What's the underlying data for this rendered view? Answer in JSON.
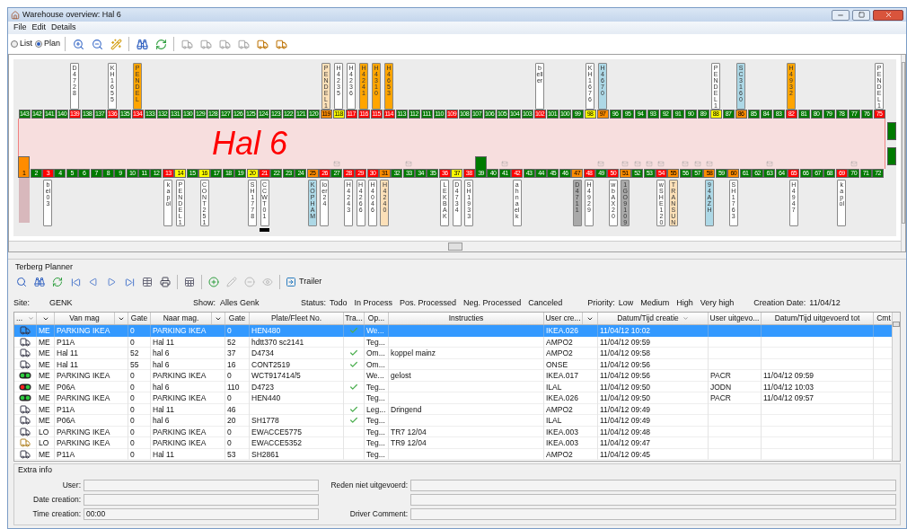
{
  "window": {
    "title": "Warehouse overview: Hal 6"
  },
  "menu": [
    "File",
    "Edit",
    "Details"
  ],
  "view_modes": [
    {
      "label": "List",
      "selected": false
    },
    {
      "label": "Plan",
      "selected": true
    }
  ],
  "truck_buttons": [
    {
      "disabled": true
    },
    {
      "disabled": true
    },
    {
      "disabled": true
    },
    {
      "disabled": true
    },
    {
      "disabled": false
    },
    {
      "disabled": false
    }
  ],
  "plan": {
    "hall_name": "Hal 6",
    "side_gates": [
      {
        "color": "#007a00"
      },
      {
        "color": "#007a00"
      }
    ],
    "top_docks": [
      {
        "no": "143",
        "color": "#007a00"
      },
      {
        "no": "142",
        "color": "#007a00"
      },
      {
        "no": "141",
        "color": "#007a00"
      },
      {
        "no": "140",
        "color": "#007a00"
      },
      {
        "no": "139",
        "color": "#ff0000",
        "label": {
          "text": "D4728",
          "color": "#ffffff"
        }
      },
      {
        "no": "138",
        "color": "#007a00"
      },
      {
        "no": "137",
        "color": "#007a00"
      },
      {
        "no": "136",
        "color": "#ff0000",
        "label": {
          "text": "KH1655",
          "color": "#ffffff"
        }
      },
      {
        "no": "135",
        "color": "#007a00"
      },
      {
        "no": "134",
        "color": "#ff0000",
        "label": {
          "text": "PENDEL",
          "color": "#ffa500"
        }
      },
      {
        "no": "133",
        "color": "#007a00"
      },
      {
        "no": "132",
        "color": "#007a00"
      },
      {
        "no": "131",
        "color": "#007a00"
      },
      {
        "no": "130",
        "color": "#007a00"
      },
      {
        "no": "129",
        "color": "#007a00"
      },
      {
        "no": "128",
        "color": "#007a00"
      },
      {
        "no": "127",
        "color": "#007a00"
      },
      {
        "no": "126",
        "color": "#007a00"
      },
      {
        "no": "125",
        "color": "#007a00"
      },
      {
        "no": "124",
        "color": "#007a00"
      },
      {
        "no": "123",
        "color": "#007a00"
      },
      {
        "no": "122",
        "color": "#007a00"
      },
      {
        "no": "121",
        "color": "#007a00"
      },
      {
        "no": "120",
        "color": "#007a00"
      },
      {
        "no": "119",
        "color": "#ff8c00",
        "label": {
          "text": "PENDEL1",
          "color": "#fce0b8"
        }
      },
      {
        "no": "118",
        "color": "#ffff00",
        "label": {
          "text": "H4235",
          "color": "#ffffff"
        }
      },
      {
        "no": "117",
        "color": "#ff0000",
        "label": {
          "text": "H4236",
          "color": "#ffffff"
        }
      },
      {
        "no": "116",
        "color": "#ff0000",
        "label": {
          "text": "H4241",
          "color": "#ffa500"
        }
      },
      {
        "no": "115",
        "color": "#ff0000",
        "label": {
          "text": "H4310",
          "color": "#ffa500"
        }
      },
      {
        "no": "114",
        "color": "#ff0000",
        "label": {
          "text": "H4653",
          "color": "#ffa500"
        }
      },
      {
        "no": "113",
        "color": "#007a00"
      },
      {
        "no": "112",
        "color": "#007a00"
      },
      {
        "no": "111",
        "color": "#007a00"
      },
      {
        "no": "110",
        "color": "#007a00"
      },
      {
        "no": "109",
        "color": "#ff0000"
      },
      {
        "no": "108",
        "color": "#007a00"
      },
      {
        "no": "107",
        "color": "#007a00"
      },
      {
        "no": "106",
        "color": "#007a00"
      },
      {
        "no": "105",
        "color": "#007a00"
      },
      {
        "no": "104",
        "color": "#007a00"
      },
      {
        "no": "103",
        "color": "#007a00"
      },
      {
        "no": "102",
        "color": "#ff0000",
        "label": {
          "text": "beller",
          "color": "#ffffff"
        }
      },
      {
        "no": "101",
        "color": "#007a00"
      },
      {
        "no": "100",
        "color": "#007a00"
      },
      {
        "no": "99",
        "color": "#007a00"
      },
      {
        "no": "98",
        "color": "#ffff00",
        "label": {
          "text": "KH1676",
          "color": "#ffffff"
        }
      },
      {
        "no": "97",
        "color": "#ff8c00",
        "label": {
          "text": "H4670",
          "color": "#add8e6"
        }
      },
      {
        "no": "96",
        "color": "#007a00"
      },
      {
        "no": "95",
        "color": "#007a00"
      },
      {
        "no": "94",
        "color": "#007a00"
      },
      {
        "no": "93",
        "color": "#007a00"
      },
      {
        "no": "92",
        "color": "#007a00"
      },
      {
        "no": "91",
        "color": "#007a00"
      },
      {
        "no": "90",
        "color": "#007a00"
      },
      {
        "no": "89",
        "color": "#007a00"
      },
      {
        "no": "88",
        "color": "#ffff00",
        "label": {
          "text": "PENDEL1",
          "color": "#ffffff"
        }
      },
      {
        "no": "87",
        "color": "#007a00"
      },
      {
        "no": "86",
        "color": "#ff8c00",
        "label": {
          "text": "SC3160",
          "color": "#add8e6"
        }
      },
      {
        "no": "85",
        "color": "#007a00"
      },
      {
        "no": "84",
        "color": "#007a00"
      },
      {
        "no": "83",
        "color": "#007a00"
      },
      {
        "no": "82",
        "color": "#ff0000",
        "label": {
          "text": "H4932",
          "color": "#ffa500"
        }
      },
      {
        "no": "81",
        "color": "#007a00"
      },
      {
        "no": "80",
        "color": "#007a00"
      },
      {
        "no": "79",
        "color": "#007a00"
      },
      {
        "no": "78",
        "color": "#007a00"
      },
      {
        "no": "77",
        "color": "#007a00"
      },
      {
        "no": "76",
        "color": "#007a00"
      },
      {
        "no": "75",
        "color": "#ff0000",
        "label": {
          "text": "PENDEL1",
          "color": "#ffffff"
        }
      }
    ],
    "bottom_docks": [
      {
        "no": "1",
        "color": "#ff8c00",
        "kind": "bay",
        "mail": false,
        "marker": false
      },
      {
        "no": "2",
        "color": "#007a00",
        "kind": "dock",
        "mail": false,
        "marker": false
      },
      {
        "no": "3",
        "color": "#ff0000",
        "kind": "dock",
        "mail": false,
        "marker": false,
        "label": {
          "text": "bel 03",
          "color": "#ffffff"
        }
      },
      {
        "no": "4",
        "color": "#007a00",
        "kind": "dock",
        "mail": false,
        "marker": false
      },
      {
        "no": "5",
        "color": "#007a00",
        "kind": "dock",
        "mail": false,
        "marker": false
      },
      {
        "no": "6",
        "color": "#007a00",
        "kind": "dock",
        "mail": false,
        "marker": false
      },
      {
        "no": "7",
        "color": "#007a00",
        "kind": "dock",
        "mail": false,
        "marker": false
      },
      {
        "no": "8",
        "color": "#007a00",
        "kind": "dock",
        "mail": false,
        "marker": false
      },
      {
        "no": "9",
        "color": "#007a00",
        "kind": "dock",
        "mail": false,
        "marker": false
      },
      {
        "no": "10",
        "color": "#007a00",
        "kind": "dock",
        "mail": false,
        "marker": false
      },
      {
        "no": "11",
        "color": "#007a00",
        "kind": "dock",
        "mail": false,
        "marker": false
      },
      {
        "no": "12",
        "color": "#007a00",
        "kind": "dock",
        "mail": false,
        "marker": false
      },
      {
        "no": "13",
        "color": "#ff0000",
        "kind": "dock",
        "mail": false,
        "marker": false,
        "label": {
          "text": "kapol",
          "color": "#ffffff"
        }
      },
      {
        "no": "14",
        "color": "#ffff00",
        "kind": "dock",
        "mail": false,
        "marker": false,
        "label": {
          "text": "PENDEL1",
          "color": "#ffffff"
        }
      },
      {
        "no": "15",
        "color": "#007a00",
        "kind": "dock",
        "mail": false,
        "marker": false
      },
      {
        "no": "16",
        "color": "#ffff00",
        "kind": "dock",
        "mail": false,
        "marker": false,
        "label": {
          "text": "CONT251",
          "color": "#ffffff"
        }
      },
      {
        "no": "17",
        "color": "#007a00",
        "kind": "dock",
        "mail": false,
        "marker": false
      },
      {
        "no": "18",
        "color": "#007a00",
        "kind": "dock",
        "mail": false,
        "marker": false
      },
      {
        "no": "19",
        "color": "#007a00",
        "kind": "dock",
        "mail": false,
        "marker": false
      },
      {
        "no": "20",
        "color": "#ffff00",
        "kind": "dock",
        "mail": false,
        "marker": false,
        "label": {
          "text": "SH1778",
          "color": "#ffffff"
        }
      },
      {
        "no": "21",
        "color": "#ff0000",
        "kind": "dock",
        "mail": false,
        "marker": true,
        "label": {
          "text": "CCWT 01",
          "color": "#ffffff"
        }
      },
      {
        "no": "22",
        "color": "#007a00",
        "kind": "dock",
        "mail": false,
        "marker": false
      },
      {
        "no": "23",
        "color": "#007a00",
        "kind": "dock",
        "mail": false,
        "marker": false
      },
      {
        "no": "24",
        "color": "#007a00",
        "kind": "dock",
        "mail": false,
        "marker": false
      },
      {
        "no": "25",
        "color": "#ff8c00",
        "kind": "dock",
        "mail": false,
        "marker": false,
        "label": {
          "text": "KOP HAM",
          "color": "#add8e6"
        }
      },
      {
        "no": "26",
        "color": "#ff0000",
        "kind": "dock",
        "mail": false,
        "marker": false,
        "label": {
          "text": "loer 24",
          "color": "#ffffff"
        }
      },
      {
        "no": "27",
        "color": "#007a00",
        "kind": "dock",
        "mail": true,
        "marker": false
      },
      {
        "no": "28",
        "color": "#ff0000",
        "kind": "dock",
        "mail": false,
        "marker": false,
        "label": {
          "text": "H4243",
          "color": "#ffffff"
        }
      },
      {
        "no": "29",
        "color": "#ff0000",
        "kind": "dock",
        "mail": false,
        "marker": false,
        "label": {
          "text": "H4266",
          "color": "#ffffff"
        }
      },
      {
        "no": "30",
        "color": "#ff0000",
        "kind": "dock",
        "mail": false,
        "marker": false,
        "label": {
          "text": "H4046",
          "color": "#ffffff"
        }
      },
      {
        "no": "31",
        "color": "#ff8c00",
        "kind": "dock",
        "mail": false,
        "marker": false,
        "label": {
          "text": "H4240",
          "color": "#fce0b8"
        }
      },
      {
        "no": "32",
        "color": "#007a00",
        "kind": "dock",
        "mail": false,
        "marker": false
      },
      {
        "no": "33",
        "color": "#007a00",
        "kind": "dock",
        "mail": true,
        "marker": false
      },
      {
        "no": "34",
        "color": "#007a00",
        "kind": "dock",
        "mail": false,
        "marker": false
      },
      {
        "no": "35",
        "color": "#007a00",
        "kind": "dock",
        "mail": false,
        "marker": false
      },
      {
        "no": "36",
        "color": "#ff0000",
        "kind": "dock",
        "mail": false,
        "marker": false,
        "label": {
          "text": "LEKBAK",
          "color": "#ffffff"
        }
      },
      {
        "no": "37",
        "color": "#ffff00",
        "kind": "dock",
        "mail": false,
        "marker": false,
        "label": {
          "text": "D4734",
          "color": "#ffffff"
        }
      },
      {
        "no": "38",
        "color": "#ff0000",
        "kind": "dock",
        "mail": false,
        "marker": false,
        "label": {
          "text": "SH1933",
          "color": "#ffffff"
        }
      },
      {
        "no": "39",
        "color": "#007a00",
        "kind": "tall",
        "mail": false,
        "marker": false
      },
      {
        "no": "40",
        "color": "#007a00",
        "kind": "dock",
        "mail": false,
        "marker": false
      },
      {
        "no": "41",
        "color": "#007a00",
        "kind": "dock",
        "mail": true,
        "marker": false
      },
      {
        "no": "42",
        "color": "#ff0000",
        "kind": "dock",
        "mail": false,
        "marker": false,
        "label": {
          "text": "ahnaelk",
          "color": "#ffffff"
        }
      },
      {
        "no": "43",
        "color": "#007a00",
        "kind": "dock",
        "mail": false,
        "marker": false
      },
      {
        "no": "44",
        "color": "#007a00",
        "kind": "dock",
        "mail": false,
        "marker": false
      },
      {
        "no": "45",
        "color": "#007a00",
        "kind": "dock",
        "mail": false,
        "marker": false
      },
      {
        "no": "46",
        "color": "#007a00",
        "kind": "dock",
        "mail": false,
        "marker": false
      },
      {
        "no": "47",
        "color": "#ff8c00",
        "kind": "dock",
        "mail": false,
        "marker": false,
        "label": {
          "text": "D4711",
          "color": "#a9a9a9"
        }
      },
      {
        "no": "48",
        "color": "#ff0000",
        "kind": "dock",
        "mail": false,
        "marker": false,
        "label": {
          "text": "H4929",
          "color": "#ffffff"
        }
      },
      {
        "no": "49",
        "color": "#007a00",
        "kind": "dock",
        "mail": true,
        "marker": false
      },
      {
        "no": "50",
        "color": "#ff0000",
        "kind": "dock",
        "mail": false,
        "marker": false,
        "label": {
          "text": "wb AX20",
          "color": "#ffffff"
        }
      },
      {
        "no": "51",
        "color": "#ff8c00",
        "kind": "dock",
        "mail": true,
        "marker": false,
        "label": {
          "text": "1GO9109",
          "color": "#a9a9a9"
        }
      },
      {
        "no": "52",
        "color": "#007a00",
        "kind": "dock",
        "mail": true,
        "marker": false
      },
      {
        "no": "53",
        "color": "#007a00",
        "kind": "dock",
        "mail": true,
        "marker": false
      },
      {
        "no": "54",
        "color": "#ff0000",
        "kind": "dock",
        "mail": true,
        "marker": false,
        "label": {
          "text": "wSHE120",
          "color": "#ffffff"
        }
      },
      {
        "no": "55",
        "color": "#ff8c00",
        "kind": "dock",
        "mail": false,
        "marker": false,
        "label": {
          "text": "TRANSUN",
          "color": "#fce0b8"
        }
      },
      {
        "no": "56",
        "color": "#007a00",
        "kind": "dock",
        "mail": true,
        "marker": false
      },
      {
        "no": "57",
        "color": "#007a00",
        "kind": "dock",
        "mail": true,
        "marker": false
      },
      {
        "no": "58",
        "color": "#ff8c00",
        "kind": "dock",
        "mail": true,
        "marker": false,
        "label": {
          "text": "94AZH",
          "color": "#add8e6"
        }
      },
      {
        "no": "59",
        "color": "#007a00",
        "kind": "dock",
        "mail": false,
        "marker": false
      },
      {
        "no": "60",
        "color": "#ff8c00",
        "kind": "dock",
        "mail": false,
        "marker": false,
        "label": {
          "text": "SH1763",
          "color": "#ffffff"
        }
      },
      {
        "no": "61",
        "color": "#007a00",
        "kind": "dock",
        "mail": false,
        "marker": false
      },
      {
        "no": "62",
        "color": "#007a00",
        "kind": "dock",
        "mail": false,
        "marker": false
      },
      {
        "no": "63",
        "color": "#007a00",
        "kind": "dock",
        "mail": true,
        "marker": false
      },
      {
        "no": "64",
        "color": "#007a00",
        "kind": "dock",
        "mail": false,
        "marker": false
      },
      {
        "no": "65",
        "color": "#ff0000",
        "kind": "dock",
        "mail": false,
        "marker": false,
        "label": {
          "text": "H4947",
          "color": "#ffffff"
        }
      },
      {
        "no": "66",
        "color": "#007a00",
        "kind": "dock",
        "mail": false,
        "marker": false
      },
      {
        "no": "67",
        "color": "#007a00",
        "kind": "dock",
        "mail": false,
        "marker": false
      },
      {
        "no": "68",
        "color": "#007a00",
        "kind": "dock",
        "mail": false,
        "marker": false
      },
      {
        "no": "69",
        "color": "#ff0000",
        "kind": "dock",
        "mail": false,
        "marker": false,
        "label": {
          "text": "kapol",
          "color": "#ffffff"
        }
      },
      {
        "no": "70",
        "color": "#007a00",
        "kind": "dock",
        "mail": true,
        "marker": false
      },
      {
        "no": "71",
        "color": "#007a00",
        "kind": "dock",
        "mail": false,
        "marker": false
      },
      {
        "no": "72",
        "color": "#007a00",
        "kind": "dock",
        "mail": false,
        "marker": false
      }
    ]
  },
  "planner": {
    "title": "Terberg Planner",
    "edit_buttons": [
      {
        "disabled": false
      },
      {
        "disabled": true
      },
      {
        "disabled": true
      },
      {
        "disabled": true
      }
    ],
    "trailer_button": "Trailer",
    "filters": {
      "site_label": "Site:",
      "site": "GENK",
      "show_label": "Show:",
      "show": "Alles Genk",
      "status_label": "Status:",
      "statuses": [
        "Todo",
        "In Process",
        "Pos. Processed",
        "Neg. Processed",
        "Canceled"
      ],
      "priority_label": "Priority:",
      "priorities": [
        "Low",
        "Medium",
        "High",
        "Very high"
      ],
      "date_label": "Creation Date:",
      "date": "11/04/12"
    },
    "columns": [
      {
        "label": "...",
        "kind": "menu"
      },
      {
        "kind": "filter"
      },
      {
        "label": "Van mag",
        "kind": "text"
      },
      {
        "kind": "filter"
      },
      {
        "label": "Gate",
        "kind": "text"
      },
      {
        "label": "Naar mag.",
        "kind": "text"
      },
      {
        "kind": "filter"
      },
      {
        "label": "Gate",
        "kind": "text"
      },
      {
        "label": "Plate/Fleet No.",
        "kind": "text"
      },
      {
        "label": "Tra...",
        "kind": "text"
      },
      {
        "label": "Op...",
        "kind": "text"
      },
      {
        "label": "Instructies",
        "kind": "text"
      },
      {
        "label": "User cre...",
        "kind": "text"
      },
      {
        "kind": "filter"
      },
      {
        "label": "Datum/Tijd creatie",
        "kind": "sorted"
      },
      {
        "label": "User uitgevo...",
        "kind": "text"
      },
      {
        "label": "Datum/Tijd uitgevoerd tot",
        "kind": "text"
      },
      {
        "label": "Cmt",
        "kind": "text"
      }
    ],
    "rows": [
      {
        "kind": "truck",
        "type": "ME",
        "van": "PARKING IKEA",
        "gate_from": "0",
        "naar": "PARKING IKEA",
        "gate_to": "0",
        "plate": "HEN480",
        "transport": true,
        "op": "We...",
        "user": "IKEA.026",
        "created": "11/04/12 10:02",
        "selected": true
      },
      {
        "kind": "truck",
        "type": "ME",
        "van": "P11A",
        "gate_from": "0",
        "naar": "Hal 11",
        "gate_to": "52",
        "plate": "hdtt370 sc2141",
        "transport": false,
        "op": "Teg...",
        "user": "AMPO2",
        "created": "11/04/12 09:59",
        "selected": false
      },
      {
        "kind": "truck",
        "type": "ME",
        "van": "Hal 11",
        "gate_from": "52",
        "naar": "hal 6",
        "gate_to": "37",
        "plate": "D4734",
        "transport": true,
        "op": "Om...",
        "instructions": "koppel mainz",
        "user": "AMPO2",
        "created": "11/04/12 09:58",
        "selected": false
      },
      {
        "kind": "truck",
        "type": "ME",
        "van": "Hal 11",
        "gate_from": "55",
        "naar": "hal 6",
        "gate_to": "16",
        "plate": "CONT2519",
        "transport": true,
        "op": "Om...",
        "user": "ONSE",
        "created": "11/04/12 09:56",
        "selected": false
      },
      {
        "kind": "light-green",
        "type": "ME",
        "van": "PARKING IKEA",
        "gate_from": "0",
        "naar": "PARKING IKEA",
        "gate_to": "0",
        "plate": "WCT917414/5",
        "transport": false,
        "op": "We...",
        "instructions": "gelost",
        "user": "IKEA.017",
        "created": "11/04/12 09:56",
        "done_by": "PACR",
        "done_at": "11/04/12 09:59",
        "selected": false
      },
      {
        "kind": "light-red",
        "type": "ME",
        "van": "P06A",
        "gate_from": "0",
        "naar": "hal 6",
        "gate_to": "110",
        "plate": "D4723",
        "transport": true,
        "op": "Teg...",
        "user": "ILAL",
        "created": "11/04/12 09:50",
        "done_by": "JODN",
        "done_at": "11/04/12 10:03",
        "selected": false
      },
      {
        "kind": "light-green",
        "type": "ME",
        "van": "PARKING IKEA",
        "gate_from": "0",
        "naar": "PARKING IKEA",
        "gate_to": "0",
        "plate": "HEN440",
        "transport": false,
        "op": "Teg...",
        "user": "IKEA.026",
        "created": "11/04/12 09:50",
        "done_by": "PACR",
        "done_at": "11/04/12 09:57",
        "selected": false
      },
      {
        "kind": "truck",
        "type": "ME",
        "van": "P11A",
        "gate_from": "0",
        "naar": "Hal 11",
        "gate_to": "46",
        "transport": true,
        "op": "Leg...",
        "instructions": "Dringend",
        "user": "AMPO2",
        "created": "11/04/12 09:49",
        "selected": false
      },
      {
        "kind": "truck",
        "type": "ME",
        "van": "P06A",
        "gate_from": "0",
        "naar": "hal 6",
        "gate_to": "20",
        "plate": "SH1778",
        "transport": true,
        "op": "Teg...",
        "user": "ILAL",
        "created": "11/04/12 09:49",
        "selected": false
      },
      {
        "kind": "truck",
        "type": "LO",
        "van": "PARKING IKEA",
        "gate_from": "0",
        "naar": "PARKING IKEA",
        "gate_to": "0",
        "plate": "EWACCE5775",
        "transport": false,
        "op": "Teg...",
        "instructions": "TR7 12/04",
        "user": "IKEA.003",
        "created": "11/04/12 09:48",
        "selected": false
      },
      {
        "kind": "trailer",
        "type": "LO",
        "van": "PARKING IKEA",
        "gate_from": "0",
        "naar": "PARKING IKEA",
        "gate_to": "0",
        "plate": "EWACCE5352",
        "transport": false,
        "op": "Teg...",
        "instructions": "TR9 12/04",
        "user": "IKEA.003",
        "created": "11/04/12 09:47",
        "selected": false
      },
      {
        "kind": "truck",
        "type": "ME",
        "van": "P11A",
        "gate_from": "0",
        "naar": "Hal 11",
        "gate_to": "53",
        "plate": "SH2861",
        "transport": false,
        "op": "Teg...",
        "user": "AMPO2",
        "created": "11/04/12 09:45",
        "selected": false
      }
    ]
  },
  "extra_info": {
    "title": "Extra info",
    "rows": [
      {
        "left": {
          "label": "User:"
        },
        "right": {
          "label": "Reden niet uitgevoerd:"
        }
      },
      {
        "left": {
          "label": "Date creation:"
        },
        "right": {}
      },
      {
        "left": {
          "label": "Time creation:",
          "value": "00:00"
        },
        "right": {
          "label": "Driver Comment:"
        }
      }
    ]
  }
}
